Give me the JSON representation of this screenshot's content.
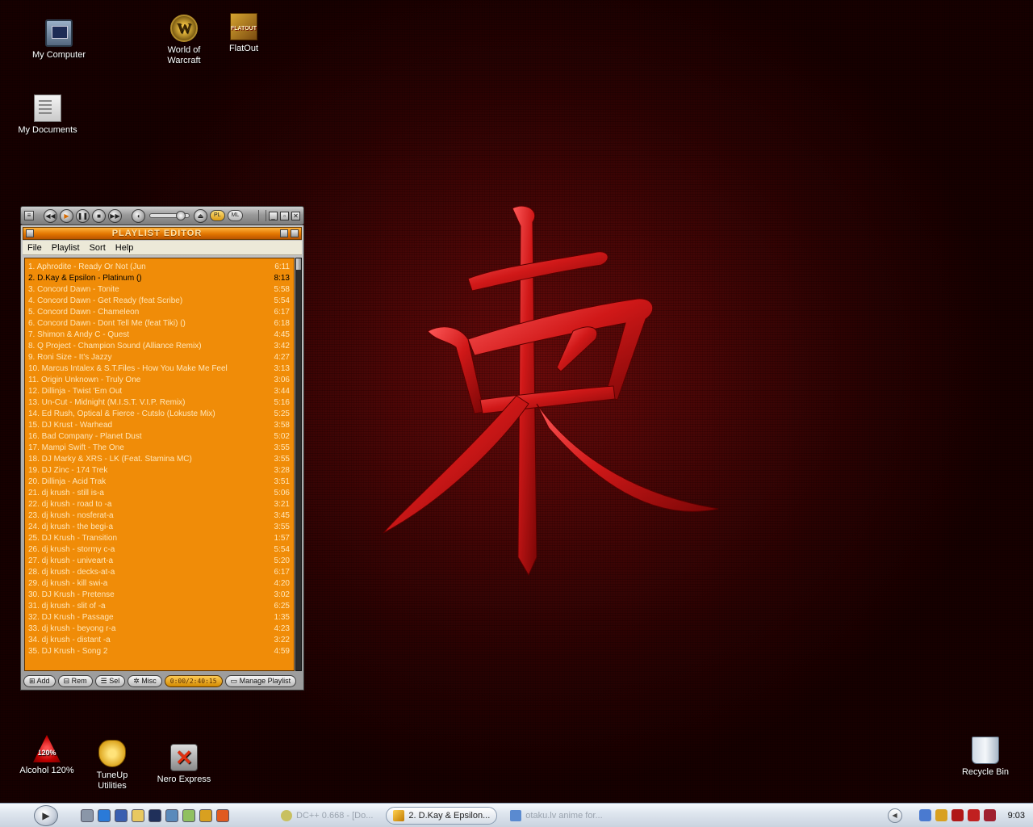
{
  "desktop": {
    "icons": [
      {
        "label": "My Computer",
        "icon": "computer-icon"
      },
      {
        "label": "World of Warcraft",
        "icon": "wow-icon"
      },
      {
        "label": "FlatOut",
        "icon": "flatout-icon"
      },
      {
        "label": "My Documents",
        "icon": "documents-icon"
      },
      {
        "label": "Alcohol 120%",
        "icon": "alcohol-icon"
      },
      {
        "label": "TuneUp Utilities",
        "icon": "tuneup-icon"
      },
      {
        "label": "Nero Express",
        "icon": "nero-icon"
      },
      {
        "label": "Recycle Bin",
        "icon": "recycle-bin-icon"
      }
    ]
  },
  "winamp": {
    "main": {
      "buttons": [
        "previous",
        "play",
        "pause",
        "stop",
        "next"
      ],
      "pills": [
        "PL",
        "ML"
      ],
      "volume_level": 0.8
    },
    "playlist": {
      "title": "PLAYLIST EDITOR",
      "menu": [
        "File",
        "Playlist",
        "Sort",
        "Help"
      ],
      "current_index": 1,
      "tracks": [
        {
          "name": "1. Aphrodite - Ready Or Not (Jun",
          "duration": "6:11"
        },
        {
          "name": "2. D.Kay & Epsilon - Platinum ()",
          "duration": "8:13"
        },
        {
          "name": "3. Concord Dawn - Tonite",
          "duration": "5:58"
        },
        {
          "name": "4. Concord Dawn - Get Ready (feat Scribe)",
          "duration": "5:54"
        },
        {
          "name": "5. Concord Dawn - Chameleon",
          "duration": "6:17"
        },
        {
          "name": "6. Concord Dawn - Dont Tell Me (feat Tiki) ()",
          "duration": "6:18"
        },
        {
          "name": "7. Shimon & Andy C - Quest",
          "duration": "4:45"
        },
        {
          "name": "8. Q Project - Champion Sound (Alliance Remix)",
          "duration": "3:42"
        },
        {
          "name": "9. Roni Size - It's Jazzy",
          "duration": "4:27"
        },
        {
          "name": "10. Marcus Intalex & S.T.Files - How You Make Me Feel",
          "duration": "3:13"
        },
        {
          "name": "11. Origin Unknown - Truly One",
          "duration": "3:06"
        },
        {
          "name": "12. Dillinja - Twist 'Em Out",
          "duration": "3:44"
        },
        {
          "name": "13. Un-Cut - Midnight (M.I.S.T. V.I.P. Remix)",
          "duration": "5:16"
        },
        {
          "name": "14. Ed Rush, Optical & Fierce - Cutslo (Lokuste Mix)",
          "duration": "5:25"
        },
        {
          "name": "15. DJ Krust - Warhead",
          "duration": "3:58"
        },
        {
          "name": "16. Bad Company - Planet Dust",
          "duration": "5:02"
        },
        {
          "name": "17. Mampi Swift - The One",
          "duration": "3:55"
        },
        {
          "name": "18. DJ Marky & XRS - LK (Feat. Stamina MC)",
          "duration": "3:55"
        },
        {
          "name": "19. DJ Zinc - 174 Trek",
          "duration": "3:28"
        },
        {
          "name": "20. Dillinja - Acid Trak",
          "duration": "3:51"
        },
        {
          "name": "21. dj krush - still is-a",
          "duration": "5:06"
        },
        {
          "name": "22. dj krush - road to -a",
          "duration": "3:21"
        },
        {
          "name": "23. dj krush - nosferat-a",
          "duration": "3:45"
        },
        {
          "name": "24. dj krush - the begi-a",
          "duration": "3:55"
        },
        {
          "name": "25. DJ Krush - Transition",
          "duration": "1:57"
        },
        {
          "name": "26. dj krush - stormy c-a",
          "duration": "5:54"
        },
        {
          "name": "27. dj krush - univeart-a",
          "duration": "5:20"
        },
        {
          "name": "28. dj krush - decks-at-a",
          "duration": "6:17"
        },
        {
          "name": "29. dj krush - kill swi-a",
          "duration": "4:20"
        },
        {
          "name": "30. DJ Krush - Pretense",
          "duration": "3:02"
        },
        {
          "name": "31. dj krush - slit of -a",
          "duration": "6:25"
        },
        {
          "name": "32. DJ Krush - Passage",
          "duration": "1:35"
        },
        {
          "name": "33. dj krush - beyong r-a",
          "duration": "4:23"
        },
        {
          "name": "34. dj krush - distant -a",
          "duration": "3:22"
        },
        {
          "name": "35. DJ Krush - Song 2",
          "duration": "4:59"
        }
      ],
      "buttons": {
        "add": "Add",
        "rem": "Rem",
        "sel": "Sel",
        "misc": "Misc",
        "time": "0:00/2:40:15",
        "manage": "Manage Playlist"
      }
    }
  },
  "taskbar": {
    "tasks": [
      {
        "label": "DC++ 0.668 - [Do...",
        "active": false
      },
      {
        "label": "2. D.Kay & Epsilon...",
        "active": true
      },
      {
        "label": "otaku.lv anime for...",
        "active": false
      }
    ],
    "clock": "9:03",
    "colors": {
      "quick_launch": [
        "#8a96a8",
        "#2a7ad8",
        "#3a5fb0",
        "#e8c860",
        "#20305a",
        "#5a8abb",
        "#90c060",
        "#d8a020",
        "#e05a20"
      ],
      "tray": [
        "#4a7ad0",
        "#d8a020",
        "#b01818",
        "#c02020",
        "#a02030"
      ]
    }
  },
  "colors": {
    "playlist_bg": "#f08c08",
    "playlist_text": "#ffe6b8",
    "playlist_current": "#000000",
    "desktop_bg": "#4a0606"
  }
}
